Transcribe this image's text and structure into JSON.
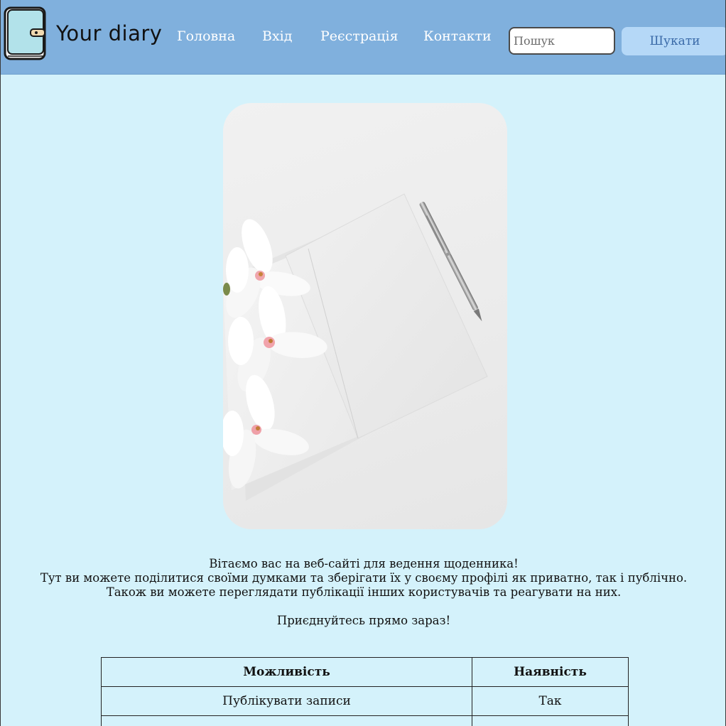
{
  "header": {
    "logo_text": "Your diary",
    "nav": [
      "Головна",
      "Вхід",
      "Реєстрація",
      "Контакти"
    ],
    "search": {
      "placeholder": "Пошук",
      "value": "",
      "button_label": "Шукати"
    }
  },
  "colors": {
    "header_bg": "#80b0dd",
    "page_bg": "#d4f2fb",
    "search_button_bg": "#b5d8f7",
    "search_button_text": "#3a6aa8"
  },
  "hero": {
    "icon": "notebook-pen-flowers-photo"
  },
  "intro": {
    "line1": "Вітаємо вас на веб-сайті для ведення щоденника!",
    "line2": "Тут ви можете поділитися своїми думками та зберігати їх у своєму профілі як приватно, так і публічно.",
    "line3": "Також ви можете переглядати публікації інших користувачів та реагувати на них.",
    "line4": "Приєднуйтесь прямо зараз!"
  },
  "table": {
    "headers": [
      "Можливість",
      "Наявність"
    ],
    "rows": [
      [
        "Публікувати записи",
        "Так"
      ],
      [
        "",
        ""
      ]
    ]
  }
}
